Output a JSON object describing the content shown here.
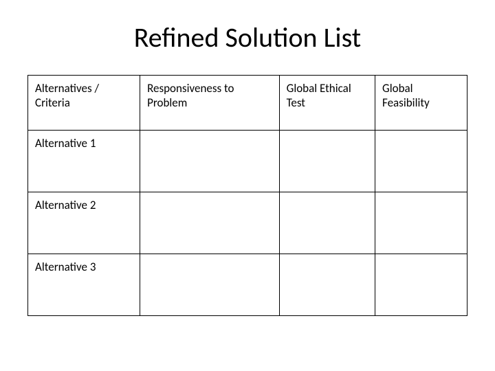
{
  "title": "Refined Solution List",
  "table": {
    "header": {
      "c0": "Alternatives / Criteria",
      "c1": "Responsiveness to Problem",
      "c2": "Global Ethical Test",
      "c3": "Global Feasibility"
    },
    "rows": [
      {
        "c0": "Alternative 1",
        "c1": "",
        "c2": "",
        "c3": ""
      },
      {
        "c0": "Alternative 2",
        "c1": "",
        "c2": "",
        "c3": ""
      },
      {
        "c0": "Alternative 3",
        "c1": "",
        "c2": "",
        "c3": ""
      }
    ]
  }
}
